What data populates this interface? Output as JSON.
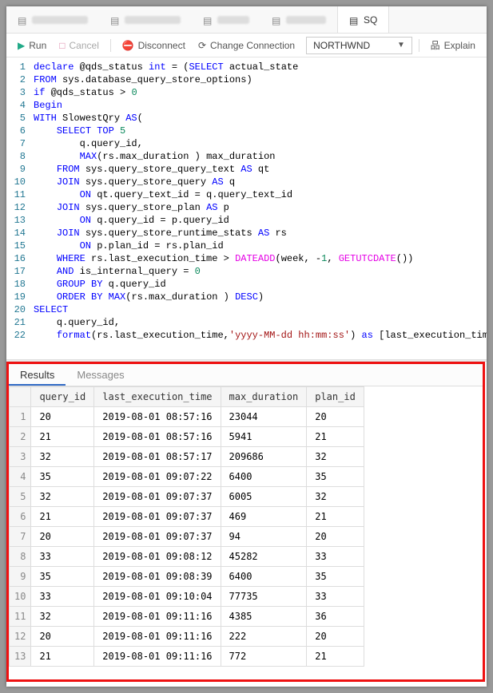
{
  "tabs": {
    "active_prefix": "SQ"
  },
  "toolbar": {
    "run": "Run",
    "cancel": "Cancel",
    "disconnect": "Disconnect",
    "change_connection": "Change Connection",
    "db_selected": "NORTHWND",
    "explain": "Explain"
  },
  "code": {
    "lines": [
      "declare @qds_status int = (SELECT actual_state",
      "FROM sys.database_query_store_options)",
      "if @qds_status > 0",
      "Begin",
      "WITH SlowestQry AS(",
      "    SELECT TOP 5",
      "        q.query_id,",
      "        MAX(rs.max_duration ) max_duration",
      "    FROM sys.query_store_query_text AS qt",
      "    JOIN sys.query_store_query AS q",
      "        ON qt.query_text_id = q.query_text_id",
      "    JOIN sys.query_store_plan AS p",
      "        ON q.query_id = p.query_id",
      "    JOIN sys.query_store_runtime_stats AS rs",
      "        ON p.plan_id = rs.plan_id",
      "    WHERE rs.last_execution_time > DATEADD(week, -1, GETUTCDATE())",
      "    AND is_internal_query = 0",
      "    GROUP BY q.query_id",
      "    ORDER BY MAX(rs.max_duration ) DESC)",
      "SELECT",
      "    q.query_id,",
      "    format(rs.last_execution_time,'yyyy-MM-dd hh:mm:ss') as [last_execution_time]"
    ]
  },
  "results": {
    "tabs": {
      "results": "Results",
      "messages": "Messages"
    },
    "columns": [
      "query_id",
      "last_execution_time",
      "max_duration",
      "plan_id"
    ],
    "rows": [
      [
        "20",
        "2019-08-01 08:57:16",
        "23044",
        "20"
      ],
      [
        "21",
        "2019-08-01 08:57:16",
        "5941",
        "21"
      ],
      [
        "32",
        "2019-08-01 08:57:17",
        "209686",
        "32"
      ],
      [
        "35",
        "2019-08-01 09:07:22",
        "6400",
        "35"
      ],
      [
        "32",
        "2019-08-01 09:07:37",
        "6005",
        "32"
      ],
      [
        "21",
        "2019-08-01 09:07:37",
        "469",
        "21"
      ],
      [
        "20",
        "2019-08-01 09:07:37",
        "94",
        "20"
      ],
      [
        "33",
        "2019-08-01 09:08:12",
        "45282",
        "33"
      ],
      [
        "35",
        "2019-08-01 09:08:39",
        "6400",
        "35"
      ],
      [
        "33",
        "2019-08-01 09:10:04",
        "77735",
        "33"
      ],
      [
        "32",
        "2019-08-01 09:11:16",
        "4385",
        "36"
      ],
      [
        "20",
        "2019-08-01 09:11:16",
        "222",
        "20"
      ],
      [
        "21",
        "2019-08-01 09:11:16",
        "772",
        "21"
      ]
    ]
  }
}
